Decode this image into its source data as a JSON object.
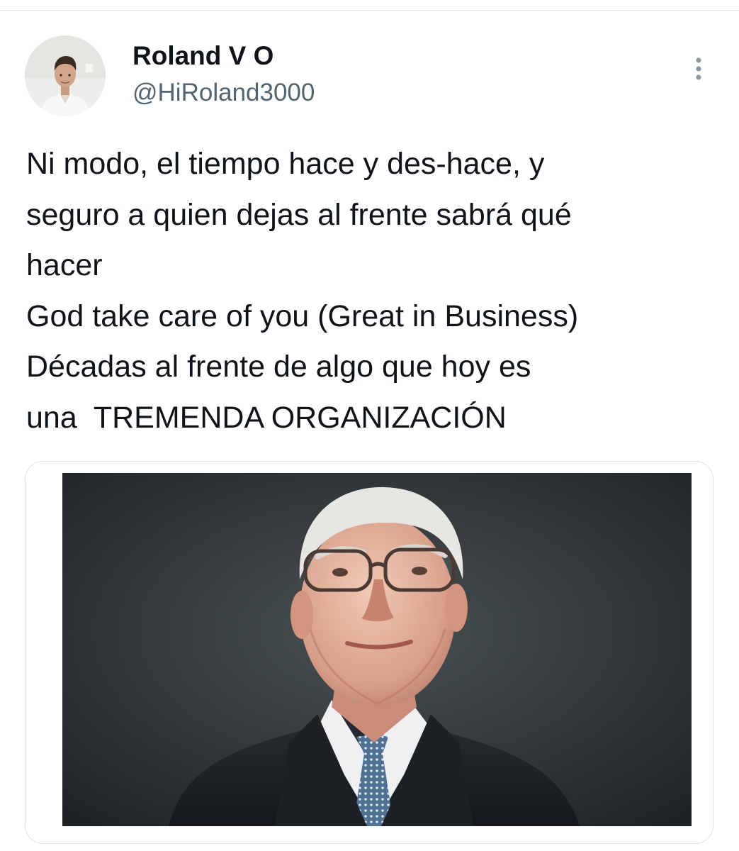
{
  "tweet": {
    "author": {
      "display_name": "Roland V O",
      "handle": "@HiRoland3000",
      "avatar_icon": "profile-photo"
    },
    "more_icon": "more-vertical-icon",
    "text_lines": [
      "Ni modo, el tiempo hace y des-hace, y",
      "seguro a quien dejas al frente sabrá qué",
      "hacer",
      "God take care of you (Great in Business)",
      "Décadas al frente de algo que hoy es",
      "una  TREMENDA ORGANIZACIÓN"
    ],
    "media": {
      "type": "photo",
      "icon": "portrait-photo"
    }
  },
  "colors": {
    "text_primary": "#0f1419",
    "text_secondary": "#536471",
    "divider": "#e6e9ec",
    "card_border": "#dfe3e6",
    "photo_background": "#2b3032"
  }
}
